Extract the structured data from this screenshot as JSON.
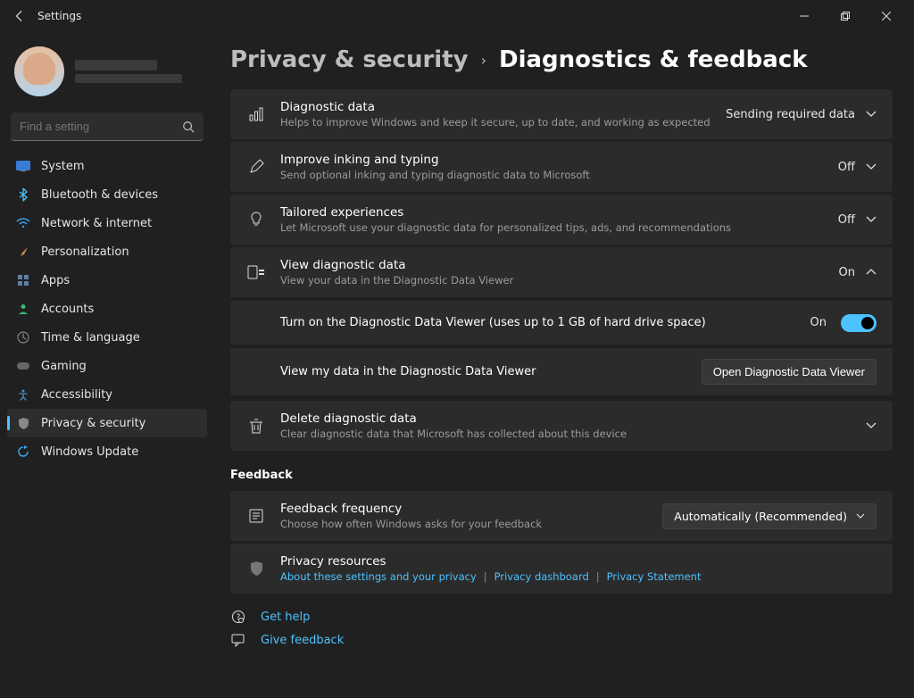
{
  "window": {
    "title": "Settings"
  },
  "search": {
    "placeholder": "Find a setting"
  },
  "sidebar": {
    "items": [
      {
        "label": "System"
      },
      {
        "label": "Bluetooth & devices"
      },
      {
        "label": "Network & internet"
      },
      {
        "label": "Personalization"
      },
      {
        "label": "Apps"
      },
      {
        "label": "Accounts"
      },
      {
        "label": "Time & language"
      },
      {
        "label": "Gaming"
      },
      {
        "label": "Accessibility"
      },
      {
        "label": "Privacy & security"
      },
      {
        "label": "Windows Update"
      }
    ]
  },
  "breadcrumb": {
    "parent": "Privacy & security",
    "current": "Diagnostics & feedback"
  },
  "cards": {
    "diag_data": {
      "title": "Diagnostic data",
      "sub": "Helps to improve Windows and keep it secure, up to date, and working as expected",
      "status": "Sending required data"
    },
    "inking": {
      "title": "Improve inking and typing",
      "sub": "Send optional inking and typing diagnostic data to Microsoft",
      "status": "Off"
    },
    "tailored": {
      "title": "Tailored experiences",
      "sub": "Let Microsoft use your diagnostic data for personalized tips, ads, and recommendations",
      "status": "Off"
    },
    "view": {
      "title": "View diagnostic data",
      "sub": "View your data in the Diagnostic Data Viewer",
      "status": "On"
    },
    "view_sub1": {
      "text": "Turn on the Diagnostic Data Viewer (uses up to 1 GB of hard drive space)",
      "state": "On"
    },
    "view_sub2": {
      "text": "View my data in the Diagnostic Data Viewer",
      "button": "Open Diagnostic Data Viewer"
    },
    "delete": {
      "title": "Delete diagnostic data",
      "sub": "Clear diagnostic data that Microsoft has collected about this device"
    }
  },
  "feedback": {
    "heading": "Feedback",
    "freq": {
      "title": "Feedback frequency",
      "sub": "Choose how often Windows asks for your feedback",
      "select": "Automatically (Recommended)"
    },
    "privacy": {
      "title": "Privacy resources",
      "link1": "About these settings and your privacy",
      "link2": "Privacy dashboard",
      "link3": "Privacy Statement"
    }
  },
  "footer": {
    "help": "Get help",
    "feedback": "Give feedback"
  }
}
